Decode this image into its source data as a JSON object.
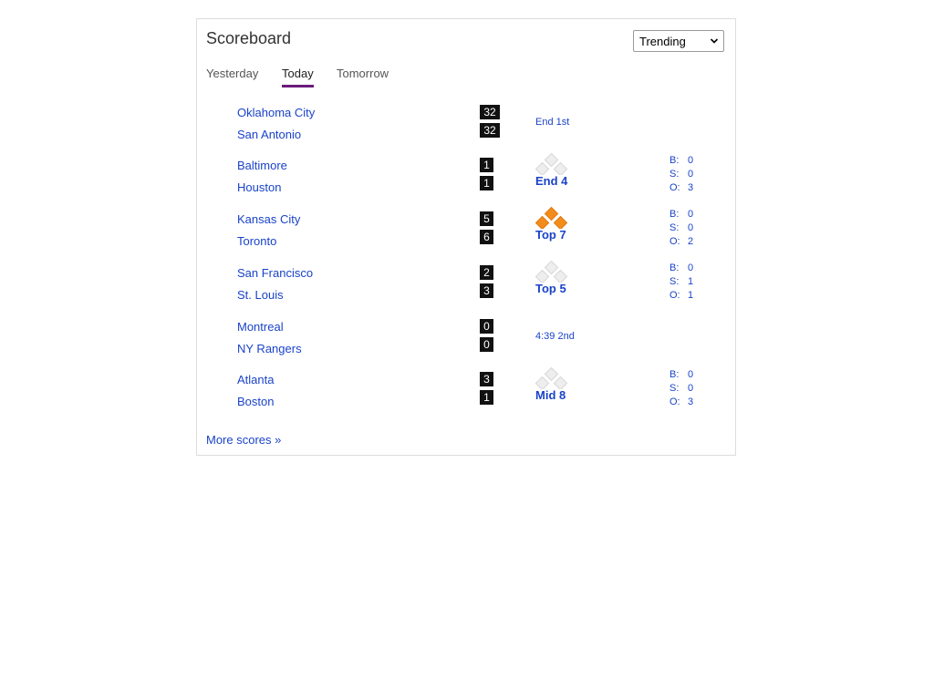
{
  "scoreboard": {
    "title": "Scoreboard",
    "filter": {
      "selected": "Trending"
    },
    "tabs": [
      {
        "label": "Yesterday",
        "active": false
      },
      {
        "label": "Today",
        "active": true
      },
      {
        "label": "Tomorrow",
        "active": false
      }
    ],
    "games": [
      {
        "away": "Oklahoma City",
        "home": "San Antonio",
        "away_score": "32",
        "home_score": "32",
        "status": "End 1st",
        "status_style": "small"
      },
      {
        "away": "Baltimore",
        "home": "Houston",
        "away_score": "1",
        "home_score": "1",
        "status": "End 4",
        "status_style": "big",
        "bases": {
          "first": false,
          "second": false,
          "third": false
        },
        "count": {
          "b_label": "B:",
          "b": "0",
          "s_label": "S:",
          "s": "0",
          "o_label": "O:",
          "o": "3"
        }
      },
      {
        "away": "Kansas City",
        "home": "Toronto",
        "away_score": "5",
        "home_score": "6",
        "status": "Top 7",
        "status_style": "big",
        "bases": {
          "first": true,
          "second": true,
          "third": true
        },
        "count": {
          "b_label": "B:",
          "b": "0",
          "s_label": "S:",
          "s": "0",
          "o_label": "O:",
          "o": "2"
        }
      },
      {
        "away": "San Francisco",
        "home": "St. Louis",
        "away_score": "2",
        "home_score": "3",
        "status": "Top 5",
        "status_style": "big",
        "bases": {
          "first": false,
          "second": false,
          "third": false
        },
        "count": {
          "b_label": "B:",
          "b": "0",
          "s_label": "S:",
          "s": "1",
          "o_label": "O:",
          "o": "1"
        }
      },
      {
        "away": "Montreal",
        "home": "NY Rangers",
        "away_score": "0",
        "home_score": "0",
        "status": "4:39 2nd",
        "status_style": "small"
      },
      {
        "away": "Atlanta",
        "home": "Boston",
        "away_score": "3",
        "home_score": "1",
        "status": "Mid 8",
        "status_style": "big",
        "bases": {
          "first": false,
          "second": false,
          "third": false
        },
        "count": {
          "b_label": "B:",
          "b": "0",
          "s_label": "S:",
          "s": "0",
          "o_label": "O:",
          "o": "3"
        }
      }
    ],
    "more_link": "More scores »"
  },
  "colors": {
    "link": "#1a43c8",
    "tab_underline": "#6a1b7a",
    "base_occupied": "#f28c1b",
    "base_empty": "#eeeeee",
    "score_bg": "#111111"
  },
  "icons": {
    "dropdown": "chevron-down-icon",
    "bases": "baseball-diamond-icon"
  }
}
